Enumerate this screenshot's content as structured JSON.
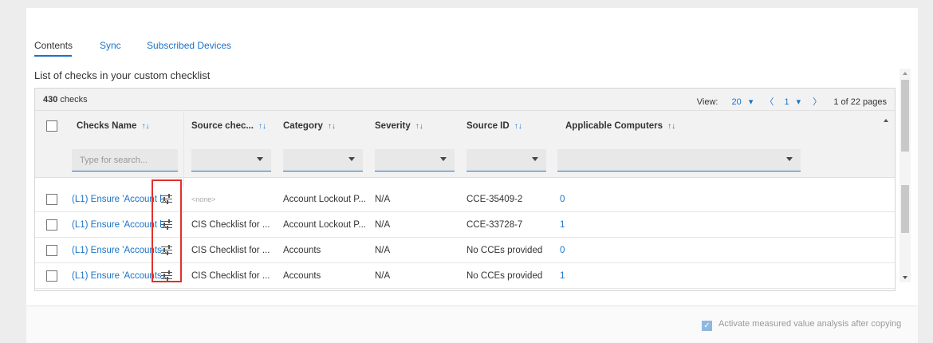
{
  "tabs": [
    {
      "label": "Contents",
      "active": true
    },
    {
      "label": "Sync",
      "active": false
    },
    {
      "label": "Subscribed Devices",
      "active": false
    }
  ],
  "subtitle": "List of checks in your custom checklist",
  "summary": {
    "count": "430",
    "count_suffix": "checks"
  },
  "pager": {
    "view_label": "View:",
    "page_size": "20",
    "prev": "〈",
    "page": "1",
    "next": "〉",
    "of_pages": "1 of 22 pages"
  },
  "columns": [
    {
      "label": "Checks Name",
      "sort": "↑↓"
    },
    {
      "label": "Source chec...",
      "sort": "↑↓"
    },
    {
      "label": "Category",
      "sort": "↑↓"
    },
    {
      "label": "Severity",
      "sort": "↑↓"
    },
    {
      "label": "Source ID",
      "sort": "↑↓"
    },
    {
      "label": "Applicable Computers",
      "sort": "↑↓"
    }
  ],
  "filters": {
    "name_placeholder": "Type for search..."
  },
  "rows": [
    {
      "name": "(L1) Ensure 'Account l...",
      "source": "<none>",
      "category": "Account Lockout P...",
      "severity": "N/A",
      "source_id": "CCE-35409-2",
      "computers": "0"
    },
    {
      "name": "(L1) Ensure 'Account l...",
      "source": "CIS Checklist for ...",
      "category": "Account Lockout P...",
      "severity": "N/A",
      "source_id": "CCE-33728-7",
      "computers": "1"
    },
    {
      "name": "(L1) Ensure 'Accounts...",
      "source": "CIS Checklist for ...",
      "category": "Accounts",
      "severity": "N/A",
      "source_id": "No CCEs provided",
      "computers": "0"
    },
    {
      "name": "(L1) Ensure 'Accounts...",
      "source": "CIS Checklist for ...",
      "category": "Accounts",
      "severity": "N/A",
      "source_id": "No CCEs provided",
      "computers": "1"
    }
  ],
  "footer": {
    "activate_label": "Activate measured value analysis after copying",
    "activate_checked": true
  },
  "colors": {
    "accent": "#1a73c8",
    "highlight": "#e0312d"
  }
}
